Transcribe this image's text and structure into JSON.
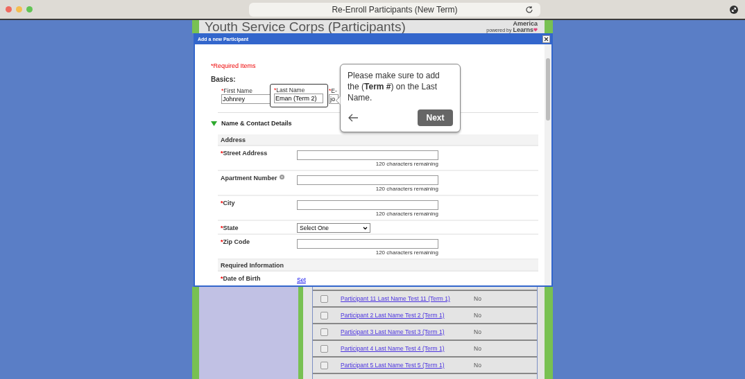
{
  "browser": {
    "title": "Re-Enroll Participants (New Term)"
  },
  "header": {
    "title": "Youth Service Corps (Participants)",
    "logo": {
      "top": "America",
      "powered": "powered by",
      "bottom": "Learns"
    }
  },
  "modal": {
    "title": "Add a new Participant",
    "required_note": "*Required Items",
    "basics_label": "Basics:",
    "basics_fields": [
      {
        "mark": "*",
        "label": "First Name",
        "value": "Johnrey",
        "highlighted": false
      },
      {
        "mark": "*",
        "label": "Last Name",
        "value": "Eman (Term 2)",
        "highlighted": true
      },
      {
        "mark": "*",
        "label": "E-",
        "value": "jo",
        "highlighted": false
      }
    ],
    "section": {
      "title": "Name & Contact Details",
      "expanded": true
    },
    "rows": [
      {
        "kind": "header",
        "label": "Address"
      },
      {
        "kind": "text",
        "mark": "*",
        "label": "Street Address",
        "help": false,
        "counter": "120 characters remaining"
      },
      {
        "kind": "text",
        "label": "Apartment Number",
        "help": true,
        "counter": "120 characters remaining"
      },
      {
        "kind": "text",
        "mark": "*",
        "label": "City",
        "help": false,
        "counter": "120 characters remaining"
      },
      {
        "kind": "select",
        "mark": "*",
        "label": "State",
        "value": "Select One"
      },
      {
        "kind": "text",
        "mark": "*",
        "label": "Zip Code",
        "help": false,
        "counter": "120 characters remaining"
      },
      {
        "kind": "header",
        "label": "Required Information"
      },
      {
        "kind": "link",
        "mark": "*",
        "label": "Date of Birth",
        "link": "Set"
      }
    ]
  },
  "tooltip": {
    "text": "Please make sure to add the (**Term #**) on the Last Name.",
    "next": "Next"
  },
  "participants": [
    {
      "name": "Participant 11 Last Name Test 11 (Term 1)",
      "value": "No",
      "checked": false
    },
    {
      "name": "Participant 2 Last Name Test 2 (Term 1)",
      "value": "No",
      "checked": false
    },
    {
      "name": "Participant 3 Last Name Test 3 (Term 1)",
      "value": "No",
      "checked": false
    },
    {
      "name": "Participant 4 Last Name Test 4 (Term 1)",
      "value": "No",
      "checked": false
    },
    {
      "name": "Participant 5 Last Name Test 5 (Term 1)",
      "value": "No",
      "checked": false
    }
  ]
}
